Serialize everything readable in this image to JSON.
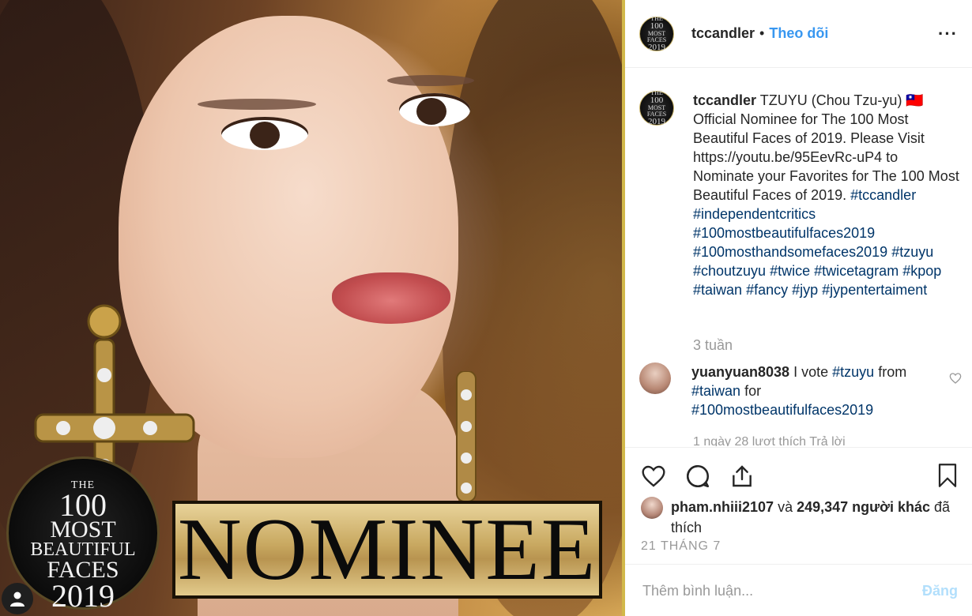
{
  "photo": {
    "badge_lines": [
      "THE",
      "100",
      "MOST",
      "BEAUTIFUL",
      "FACES",
      "2019"
    ],
    "nominee_text": "NOMINEE"
  },
  "header": {
    "username": "tccandler",
    "separator": "•",
    "follow_label": "Theo dõi",
    "more_label": "···",
    "logo_lines": [
      "THE",
      "100",
      "MOST",
      "BEAUTIFUL",
      "FACES",
      "2019"
    ]
  },
  "caption": {
    "username": "tccandler",
    "text_1": "TZUYU (Chou Tzu-yu) 🇹🇼 Official Nominee for The 100 Most Beautiful Faces of 2019. Please Visit https://youtu.be/95EevRc-uP4 to Nominate your Favorites for The 100 Most Beautiful Faces of 2019.",
    "hashtags": [
      "#tccandler",
      "#independentcritics",
      "#100mostbeautifulfaces2019",
      "#100mosthandsomefaces2019",
      "#tzuyu",
      "#choutzuyu",
      "#twice",
      "#twicetagram",
      "#kpop",
      "#taiwan",
      "#fancy",
      "#jyp",
      "#jypentertaiment"
    ],
    "time": "3 tuần"
  },
  "comment": {
    "username": "yuanyuan8038",
    "text_pre": "I vote",
    "tag1": "#tzuyu",
    "text_mid": "from",
    "tag2": "#taiwan",
    "text_post": "for",
    "tag3": "#100mostbeautifulfaces2019",
    "footer": "1 ngày   28 lượt thích   Trả lời"
  },
  "actions": {
    "liked_by_user": "pham.nhiii2107",
    "liked_connector": "và",
    "liked_count": "249,347 người khác",
    "liked_suffix": "đã thích",
    "date": "21 THÁNG 7"
  },
  "composer": {
    "placeholder": "Thêm bình luận...",
    "post_label": "Đăng"
  },
  "colors": {
    "link_blue": "#3897f0",
    "hashtag": "#003569",
    "muted": "#999999",
    "post_disabled": "#b2dffc"
  }
}
